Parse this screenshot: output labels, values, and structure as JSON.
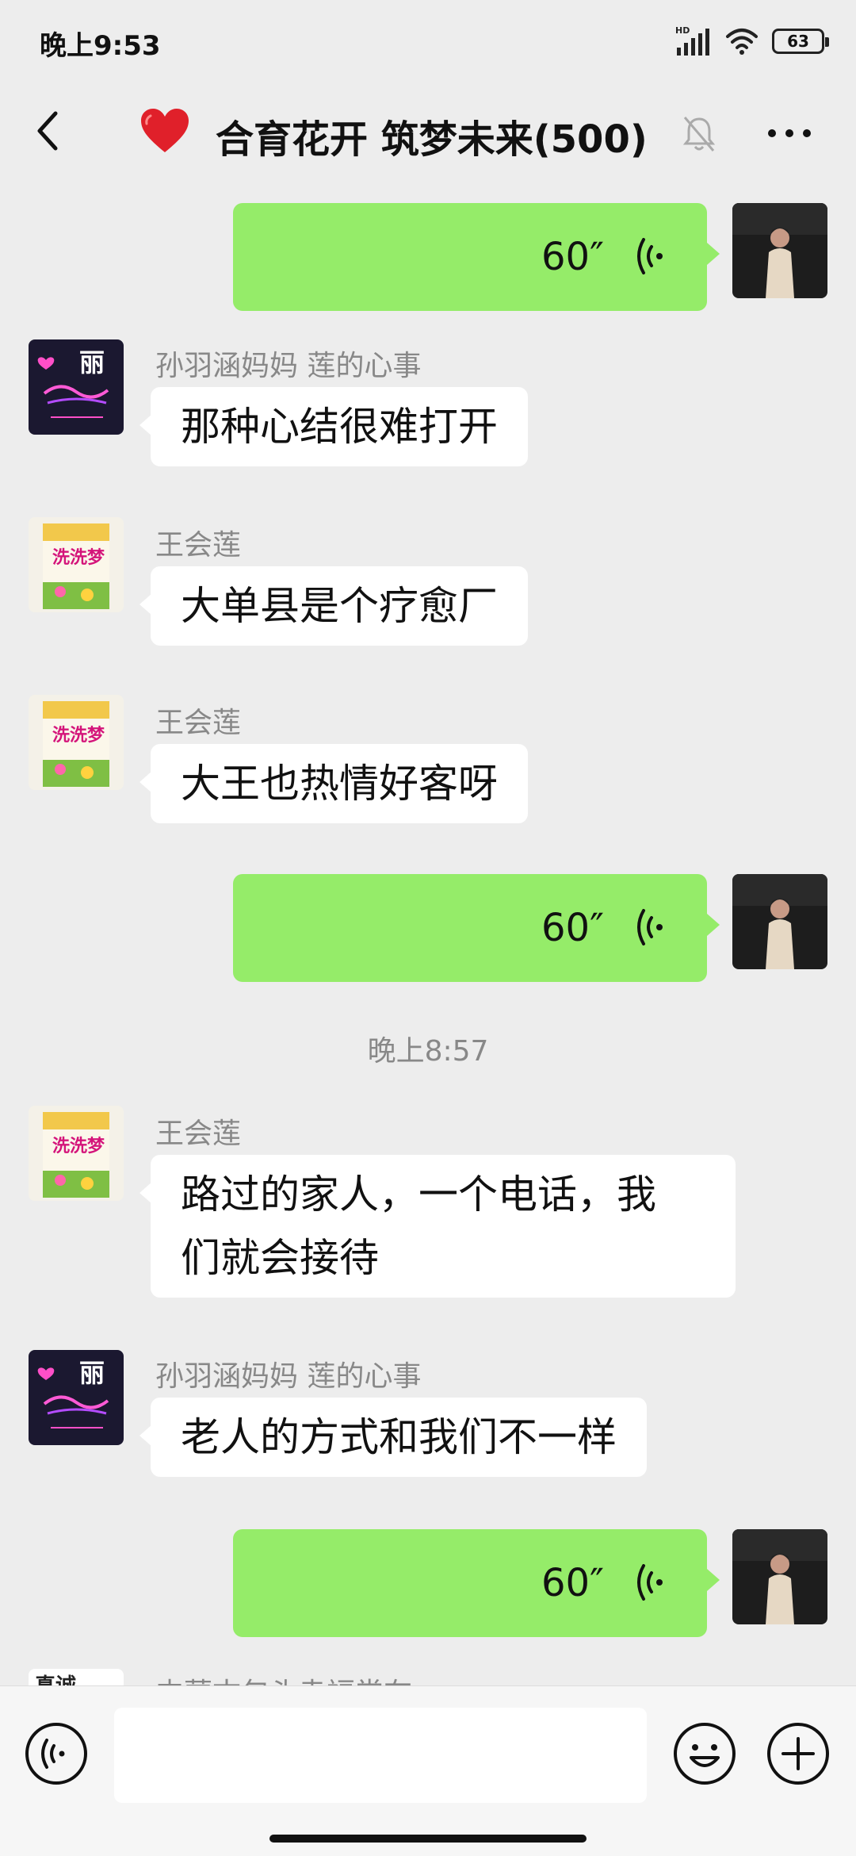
{
  "status_bar": {
    "time": "晚上9:53",
    "signal_label": "HD",
    "battery": "63"
  },
  "nav": {
    "title": "合育花开 筑梦未来(500)"
  },
  "avatars": {
    "me": "self-photo-avatar",
    "sun_mother": {
      "text": "丽"
    },
    "wang": {
      "text": "洗洗梦"
    },
    "partial": {
      "text": "真诚"
    }
  },
  "messages": [
    {
      "type": "voice",
      "from": "me",
      "duration": "60″"
    },
    {
      "type": "text",
      "from": "孙羽涵妈妈 莲的心事",
      "text": "那种心结很难打开"
    },
    {
      "type": "text",
      "from": "王会莲",
      "text": "大单县是个疗愈厂"
    },
    {
      "type": "text",
      "from": "王会莲",
      "text": "大王也热情好客呀"
    },
    {
      "type": "voice",
      "from": "me",
      "duration": "60″"
    },
    {
      "type": "timestamp",
      "text": "晚上8:57"
    },
    {
      "type": "text",
      "from": "王会莲",
      "text_lines": [
        "路过的家人，一个电话，我",
        "们就会接待"
      ]
    },
    {
      "type": "text",
      "from": "孙羽涵妈妈 莲的心事",
      "text": "老人的方式和我们不一样"
    },
    {
      "type": "voice",
      "from": "me",
      "duration": "60″"
    },
    {
      "type": "text_partial",
      "from": "内蒙古包头幸福常在"
    }
  ],
  "input": {
    "value": "",
    "placeholder": ""
  },
  "colors": {
    "bg": "#ededed",
    "bubble_out": "#95ec69",
    "bubble_in": "#ffffff",
    "meta_text": "#888888"
  }
}
